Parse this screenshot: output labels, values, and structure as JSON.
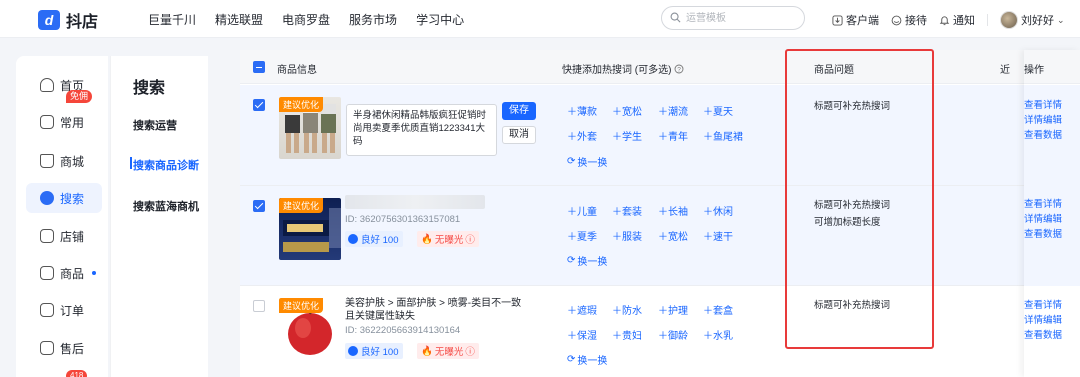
{
  "brand": {
    "name": "抖店"
  },
  "nav": [
    "巨量千川",
    "精选联盟",
    "电商罗盘",
    "服务市场",
    "学习中心"
  ],
  "search": {
    "placeholder": "运营模板"
  },
  "topright": {
    "client": "客户端",
    "reception": "接待",
    "notify": "通知",
    "user": "刘好好"
  },
  "sidebar": {
    "items": [
      {
        "label": "首页",
        "icon": "home-icon"
      },
      {
        "label": "常用",
        "icon": "folder-icon"
      },
      {
        "label": "商城",
        "icon": "mall-icon"
      },
      {
        "label": "搜索",
        "icon": "search-icon"
      },
      {
        "label": "店铺",
        "icon": "store-icon"
      },
      {
        "label": "商品",
        "icon": "bag-icon"
      },
      {
        "label": "订单",
        "icon": "order-icon"
      },
      {
        "label": "售后",
        "icon": "aftersale-icon"
      }
    ],
    "free_badge": "免佣",
    "bottom_badge": "418"
  },
  "submenu": {
    "title": "搜索",
    "items": [
      "搜索运营",
      "搜索商品诊断",
      "搜索蓝海商机"
    ]
  },
  "table": {
    "headers": {
      "product": "商品信息",
      "keywords": "快捷添加热搜词 (可多选)",
      "issue": "商品问题",
      "cut": "近",
      "ops": "操作"
    },
    "suggest_tag": "建议优化",
    "refresh_label": "换一换",
    "rows": [
      {
        "checked": true,
        "edit_text": "半身裙休闲精品韩版疯狂促销时尚甩卖夏季优质直销1223341大码",
        "save": "保存",
        "cancel": "取消",
        "keywords": [
          "薄款",
          "宽松",
          "潮流",
          "夏天",
          "外套",
          "学生",
          "青年",
          "鱼尾裙"
        ],
        "issues": [
          "标题可补充热搜词"
        ],
        "ops": [
          "查看详情",
          "详情编辑",
          "查看数据"
        ]
      },
      {
        "checked": true,
        "id": "ID: 3620756301363157081",
        "good": "良好 100",
        "bad": "无曝光",
        "keywords": [
          "儿童",
          "套装",
          "长袖",
          "休闲",
          "夏季",
          "服装",
          "宽松",
          "速干"
        ],
        "issues": [
          "标题可补充热搜词",
          "可增加标题长度"
        ],
        "ops": [
          "查看详情",
          "详情编辑",
          "查看数据"
        ]
      },
      {
        "checked": false,
        "title": "美容护肤 > 面部护肤 > 喷雾-类目不一致且关键属性缺失",
        "id": "ID: 3622205663914130164",
        "good": "良好 100",
        "bad": "无曝光",
        "keywords": [
          "遮瑕",
          "防水",
          "护理",
          "套盒",
          "保湿",
          "贵妇",
          "御龄",
          "水乳"
        ],
        "issues": [
          "标题可补充热搜词"
        ],
        "ops": [
          "查看详情",
          "详情编辑",
          "查看数据"
        ]
      }
    ]
  },
  "colors": {
    "accent": "#1966ff",
    "warn": "#ff8a00",
    "danger": "#f54a45",
    "highlight": "#e83a3a"
  }
}
